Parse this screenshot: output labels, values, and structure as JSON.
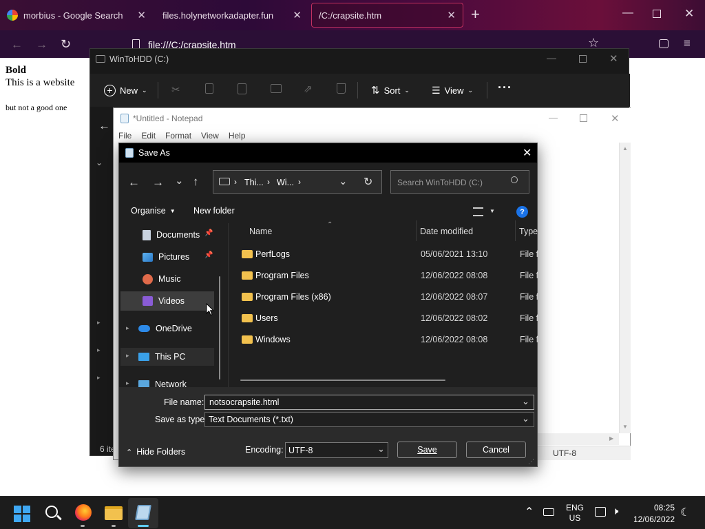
{
  "browser": {
    "tabs": [
      {
        "title": "morbius - Google Search"
      },
      {
        "title": "files.holynetworkadapter.fun"
      },
      {
        "title": "/C:/crapsite.htm"
      }
    ],
    "url": "file:///C:/crapsite.htm"
  },
  "page": {
    "bold": "Bold",
    "line1": "This is a website",
    "line2": "but not a good one"
  },
  "explorer": {
    "title": "WinToHDD (C:)",
    "toolbar": {
      "new": "New",
      "sort": "Sort",
      "view": "View"
    },
    "status": "6 ite"
  },
  "notepad": {
    "title": "*Untitled - Notepad",
    "menu": [
      "File",
      "Edit",
      "Format",
      "View",
      "Help"
    ],
    "encoding": "UTF-8"
  },
  "dialog": {
    "title": "Save As",
    "breadcrumb": [
      "Thi...",
      "Wi..."
    ],
    "search_placeholder": "Search WinToHDD (C:)",
    "organise": "Organise",
    "new_folder": "New folder",
    "nav": [
      {
        "label": "Documents",
        "icon": "documents-icon",
        "pinned": true
      },
      {
        "label": "Pictures",
        "icon": "pictures-icon",
        "pinned": true
      },
      {
        "label": "Music",
        "icon": "music-icon"
      },
      {
        "label": "Videos",
        "icon": "videos-icon"
      },
      {
        "label": "OneDrive",
        "icon": "onedrive-icon"
      },
      {
        "label": "This PC",
        "icon": "this-pc-icon"
      },
      {
        "label": "Network",
        "icon": "network-icon"
      }
    ],
    "columns": {
      "name": "Name",
      "date": "Date modified",
      "type": "Type"
    },
    "files": [
      {
        "name": "PerfLogs",
        "date": "05/06/2021 13:10",
        "type": "File fo"
      },
      {
        "name": "Program Files",
        "date": "12/06/2022 08:08",
        "type": "File fo"
      },
      {
        "name": "Program Files (x86)",
        "date": "12/06/2022 08:07",
        "type": "File fo"
      },
      {
        "name": "Users",
        "date": "12/06/2022 08:02",
        "type": "File fo"
      },
      {
        "name": "Windows",
        "date": "12/06/2022 08:08",
        "type": "File fo"
      }
    ],
    "file_name_label": "File name:",
    "file_name_value": "notsocrapsite.html",
    "save_type_label": "Save as type:",
    "save_type_value": "Text Documents (*.txt)",
    "hide_folders": "Hide Folders",
    "encoding_label": "Encoding:",
    "encoding_value": "UTF-8",
    "save": "Save",
    "cancel": "Cancel"
  },
  "taskbar": {
    "lang_top": "ENG",
    "lang_bottom": "US",
    "time": "08:25",
    "date": "12/06/2022"
  },
  "colors": {
    "accent": "#60cdff",
    "folder": "#f2c14e",
    "browser_active_tab": "#c23060"
  }
}
